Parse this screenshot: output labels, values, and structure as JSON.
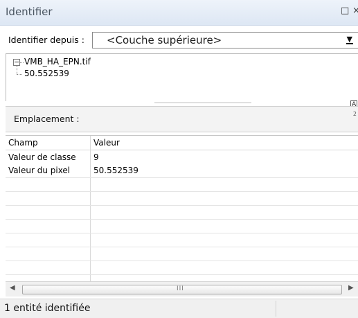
{
  "window": {
    "title": "Identifier",
    "restore_glyph": "□",
    "close_glyph": "×"
  },
  "identify_from": {
    "label": "Identifier depuis :",
    "selected": "<Couche supérieure>"
  },
  "tree": {
    "layer": "VMB_HA_EPN.tif",
    "value": "50.552539"
  },
  "location": {
    "label": "Emplacement :"
  },
  "table": {
    "columns": [
      "Champ",
      "Valeur"
    ],
    "rows": [
      {
        "field": "Valeur de classe",
        "value": "9"
      },
      {
        "field": "Valeur du pixel",
        "value": "50.552539"
      }
    ]
  },
  "scrollbar": {
    "grip": "III"
  },
  "status": {
    "text": "1 entité identifiée"
  }
}
